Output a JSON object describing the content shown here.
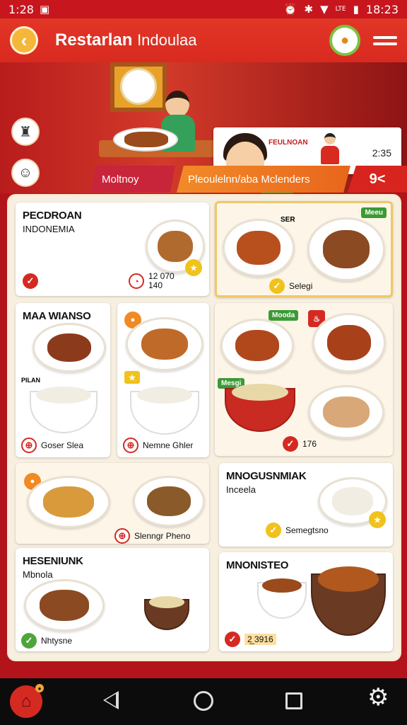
{
  "status_bar": {
    "time": "1:28",
    "clock_right": "18:23",
    "carrier": "LTE",
    "icons": [
      "photo-icon",
      "alarm-icon",
      "bluetooth-off-icon",
      "wifi-icon",
      "signal-icon",
      "battery-icon"
    ]
  },
  "app_bar": {
    "title_bold": "Restarlan",
    "title_thin": "Indoulaa"
  },
  "chef_card": {
    "label": "FEULNOAN",
    "time": "2:35"
  },
  "tabs": [
    {
      "label": "Moltnoy"
    },
    {
      "label": "Pleoulelnn/aba Mclenders"
    },
    {
      "label": "9<"
    }
  ],
  "cards": {
    "c1": {
      "title": "PECDROAN",
      "sub": "INDONEMIA",
      "foot": "12 070\n140"
    },
    "c2": {
      "badge": "Meeu",
      "corner": "SER",
      "foot": "Selegi"
    },
    "c3": {
      "title": "MAA WIANSO",
      "tag": "PILAN",
      "foot": "Goser Slea"
    },
    "c4": {
      "foot": "Nemne Ghler"
    },
    "c5": {
      "badge1": "Mooda",
      "badge2": "Mesgi",
      "foot": "176"
    },
    "c6": {
      "foot": "Slenngr Pheno"
    },
    "c7": {
      "title": "MNOGUSNMIAK",
      "sub": "Inceela",
      "foot": "Semegtsno"
    },
    "c8": {
      "title": "HESENIUNK",
      "sub": "Mbnola",
      "foot": "Nhtysne"
    },
    "c9": {
      "title": "MNONISTEO",
      "foot": "2̲ 3916"
    }
  },
  "colors": {
    "primary": "#d92a20",
    "accent": "#f28a28",
    "board": "#f7efe0"
  }
}
